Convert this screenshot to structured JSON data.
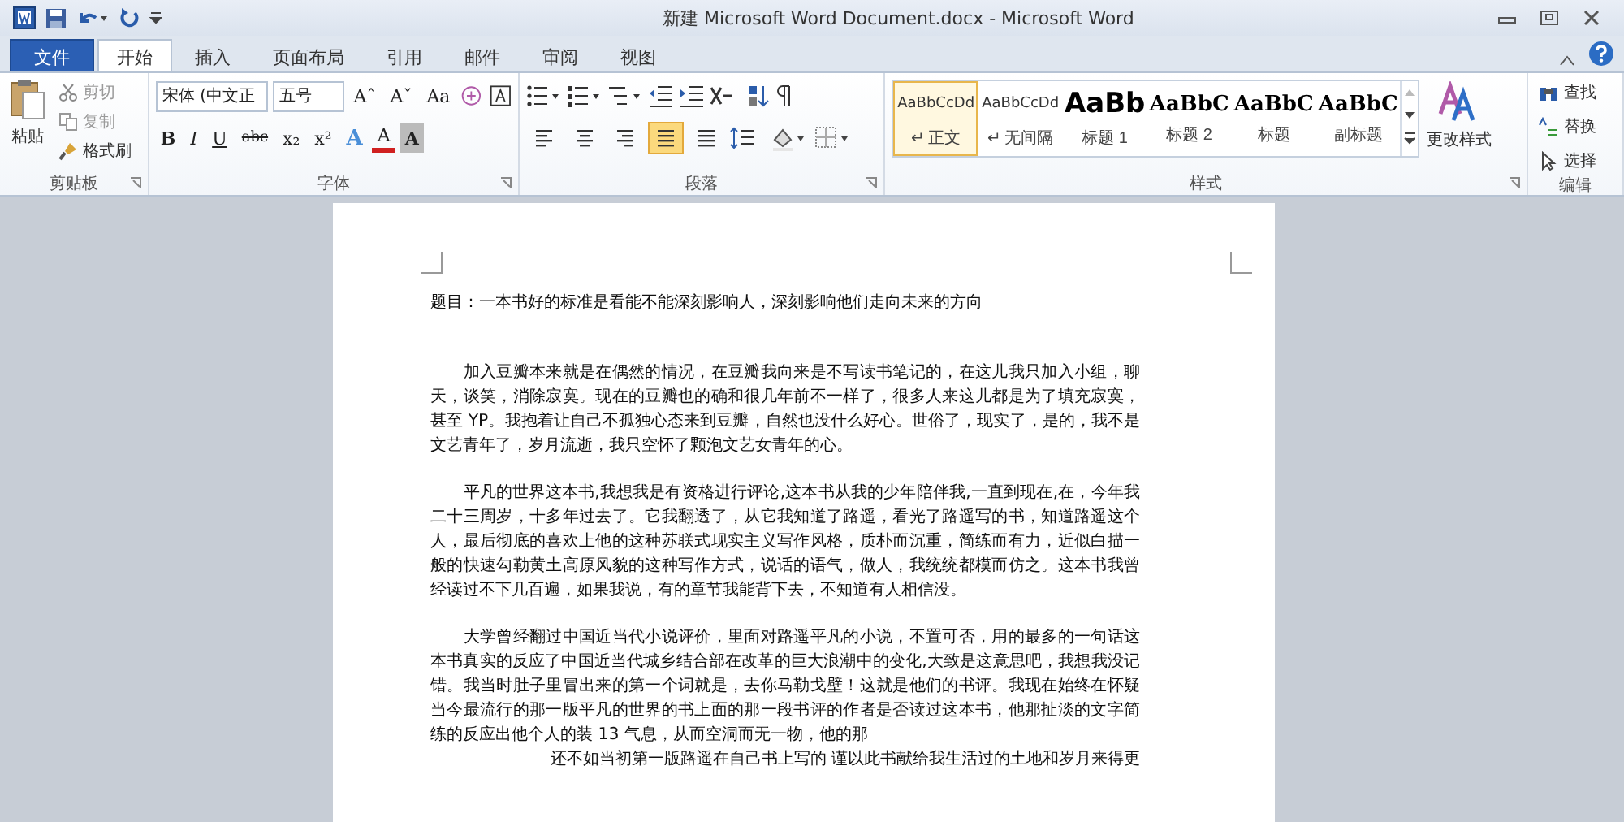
{
  "window": {
    "title": "新建 Microsoft Word Document.docx - Microsoft Word"
  },
  "tabs": [
    {
      "label": "文件",
      "kind": "file",
      "selected": false
    },
    {
      "label": "开始",
      "kind": "tab",
      "selected": true
    },
    {
      "label": "插入",
      "kind": "tab",
      "selected": false
    },
    {
      "label": "页面布局",
      "kind": "tab",
      "selected": false
    },
    {
      "label": "引用",
      "kind": "tab",
      "selected": false
    },
    {
      "label": "邮件",
      "kind": "tab",
      "selected": false
    },
    {
      "label": "审阅",
      "kind": "tab",
      "selected": false
    },
    {
      "label": "视图",
      "kind": "tab",
      "selected": false
    }
  ],
  "clipboard": {
    "label": "剪贴板",
    "paste": "粘贴",
    "items": [
      {
        "label": "剪切",
        "kind": "cut",
        "disabled": true
      },
      {
        "label": "复制",
        "kind": "copy",
        "disabled": true
      },
      {
        "label": "格式刷",
        "kind": "brush",
        "disabled": false
      }
    ]
  },
  "font": {
    "label": "字体",
    "font_name": "宋体 (中文正",
    "font_size": "五号",
    "row1": [
      "Aˆ",
      "Aˇ",
      "Aa"
    ],
    "row2": [
      {
        "label": "B",
        "kind": "bold"
      },
      {
        "label": "I",
        "kind": "italic"
      },
      {
        "label": "U",
        "kind": "underline"
      },
      {
        "label": "abc",
        "kind": "strike"
      },
      {
        "label": "x₂",
        "kind": "sub"
      },
      {
        "label": "x²",
        "kind": "sup"
      },
      {
        "label": "A",
        "kind": "effect"
      },
      {
        "label": "A",
        "kind": "color"
      },
      {
        "label": "A",
        "kind": "shade"
      }
    ]
  },
  "paragraph": {
    "label": "段落",
    "row2": [
      {
        "kind": "left",
        "selected": false
      },
      {
        "kind": "center",
        "selected": false
      },
      {
        "kind": "right",
        "selected": false
      },
      {
        "kind": "justify",
        "selected": true
      },
      {
        "kind": "distributed",
        "selected": false
      }
    ]
  },
  "styles": {
    "label": "样式",
    "items": [
      {
        "preview": "AaBbCcDd",
        "name": "↵ 正文",
        "kind": "normal",
        "selected": true
      },
      {
        "preview": "AaBbCcDd",
        "name": "↵ 无间隔",
        "kind": "normal",
        "selected": false
      },
      {
        "preview": "AaBb",
        "name": "标题 1",
        "kind": "heading1",
        "selected": false
      },
      {
        "preview": "AaBbC",
        "name": "标题 2",
        "kind": "heading",
        "selected": false
      },
      {
        "preview": "AaBbC",
        "name": "标题",
        "kind": "heading",
        "selected": false
      },
      {
        "preview": "AaBbC",
        "name": "副标题",
        "kind": "heading",
        "selected": false
      }
    ],
    "change": "更改样式"
  },
  "editing": {
    "label": "编辑",
    "items": [
      {
        "label": "查找",
        "kind": "find"
      },
      {
        "label": "替换",
        "kind": "replace"
      },
      {
        "label": "选择",
        "kind": "select"
      }
    ]
  },
  "document": {
    "title": "题目：一本书好的标准是看能不能深刻影响人，深刻影响他们走向未来的方向",
    "paragraphs": [
      "加入豆瓣本来就是在偶然的情况，在豆瓣我向来是不写读书笔记的，在这儿我只加入小组，聊天，谈笑，消除寂寞。现在的豆瓣也的确和很几年前不一样了，很多人来这儿都是为了填充寂寞，甚至 YP。我抱着让自己不孤独心态来到豆瓣，自然也没什么好心。世俗了，现实了，是的，我不是文艺青年了，岁月流逝，我只空怀了颗泡文艺女青年的心。",
      "平凡的世界这本书,我想我是有资格进行评论,这本书从我的少年陪伴我,一直到现在,在，今年我二十三周岁，十多年过去了。它我翻透了，从它我知道了路遥，看光了路遥写的书，知道路遥这个人，最后彻底的喜欢上他的这种苏联式现实主义写作风格，质朴而沉重，简练而有力，近似白描一般的快速勾勒黄土高原风貌的这种写作方式，说话的语气，做人，我统统都模而仿之。这本书我曾经读过不下几百遍，如果我说，有的章节我能背下去，不知道有人相信没。",
      "大学曾经翻过中国近当代小说评价，里面对路遥平凡的小说，不置可否，用的最多的一句话这本书真实的反应了中国近当代城乡结合部在改革的巨大浪潮中的变化,大致是这意思吧，我想我没记错。我当时肚子里冒出来的第一个词就是，去你马勒戈壁！这就是他们的书评。我现在始终在怀疑当今最流行的那一版平凡的世界的书上面的那一段书评的作者是否读过这本书，他那扯淡的文字简练的反应出他个人的装 13 气息，从而空洞而无一物，他的那"
    ],
    "last_line": "还不如当初第一版路遥在自己书上写的 谨以此书献给我生活过的土地和岁月来得更"
  }
}
